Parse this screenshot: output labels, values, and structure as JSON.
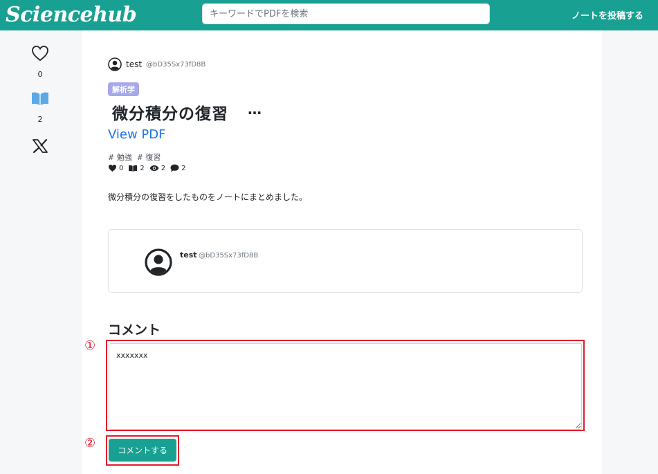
{
  "header": {
    "logo": "Sciencehub",
    "search_placeholder": "キーワードでPDFを検索",
    "post_note_label": "ノートを投稿する"
  },
  "sidebar": {
    "like_count": "0",
    "bookmark_count": "2"
  },
  "note": {
    "author_name": "test",
    "author_handle": "@bD35Sx73fD8B",
    "category": "解析学",
    "title": "微分積分の復習",
    "more_label": "…",
    "view_pdf_label": "View PDF",
    "tags": [
      "# 勉強",
      "# 復習"
    ],
    "stats": {
      "likes": "0",
      "bookmarks": "2",
      "views": "2",
      "comments": "2"
    },
    "description": "微分積分の復習をしたものをノートにまとめました。"
  },
  "author_card": {
    "name": "test",
    "handle": "@bD35Sx73fD8B"
  },
  "comments": {
    "heading": "コメント",
    "input_value": "xxxxxxx",
    "submit_label": "コメントする",
    "marker_1": "①",
    "marker_2": "②"
  },
  "colors": {
    "brand": "#18a192",
    "badge": "#a6a8ea",
    "link": "#1a73e8",
    "annotation": "#e11d2e"
  }
}
